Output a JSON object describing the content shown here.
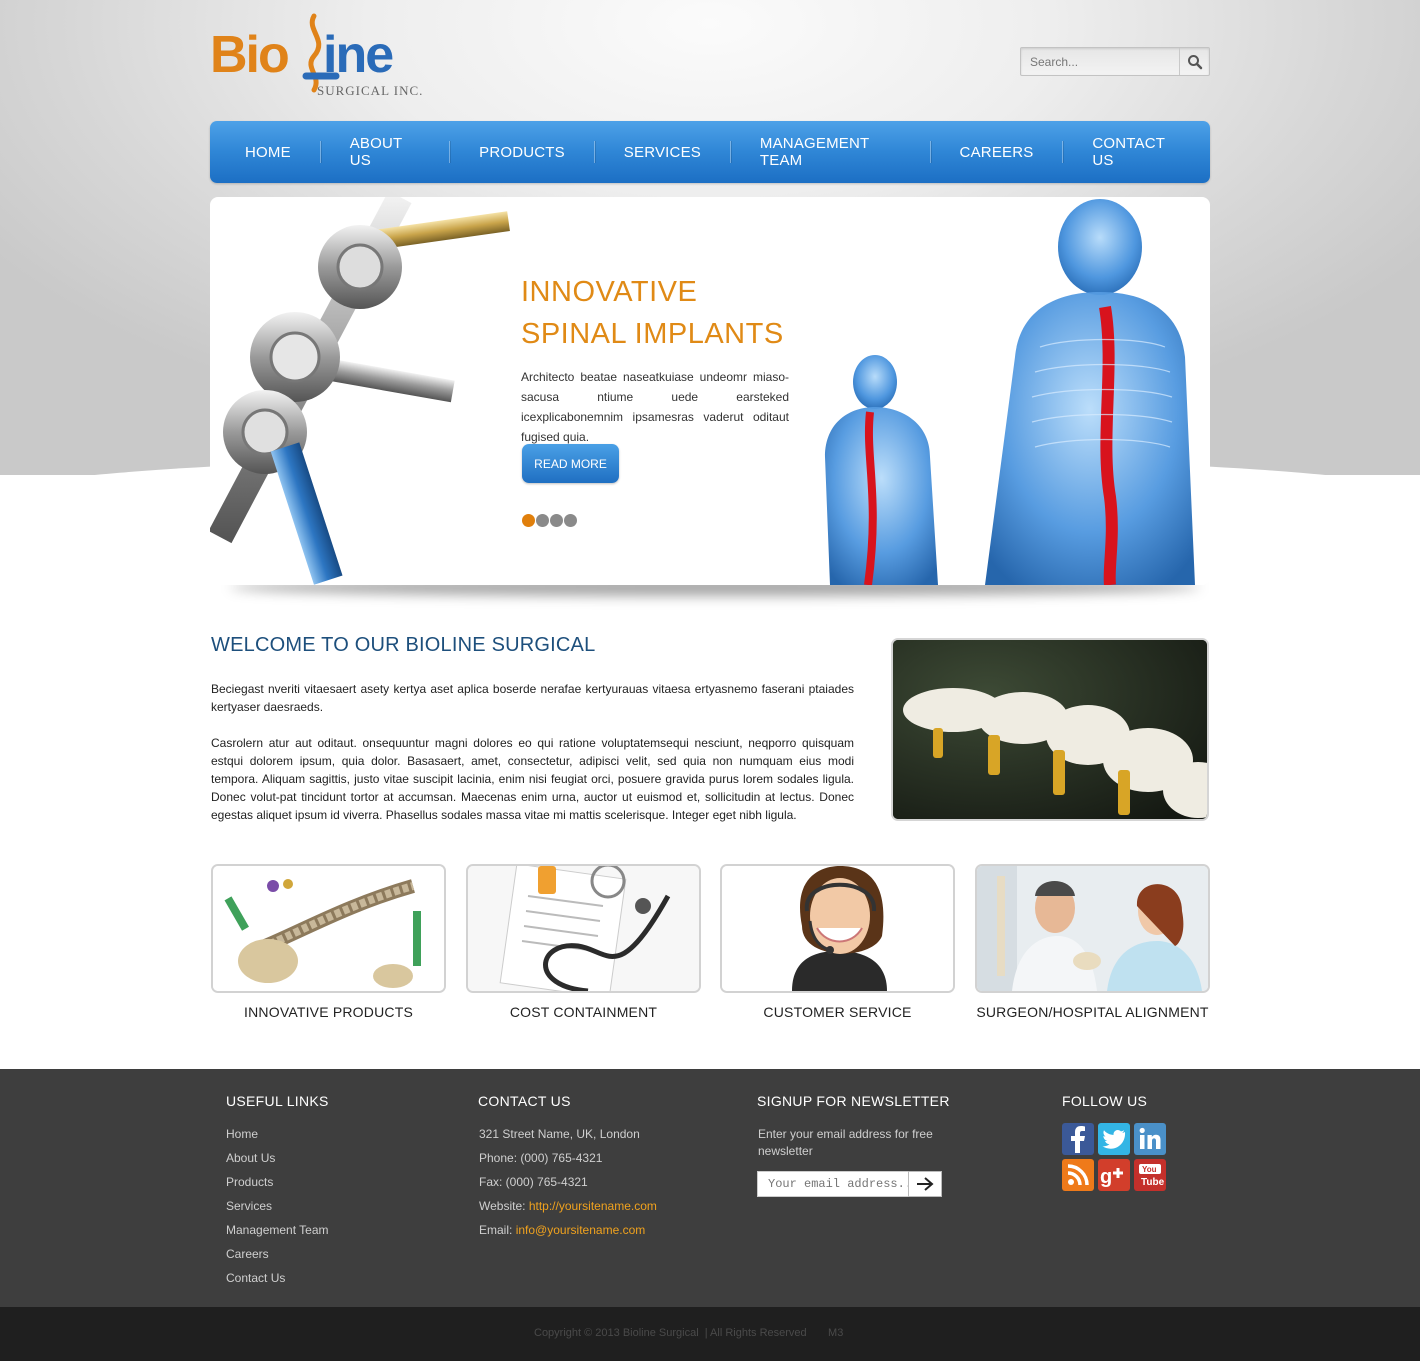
{
  "header": {
    "logo_text": "BioLine",
    "logo_sub": "SURGICAL INC.",
    "search_placeholder": "Search..."
  },
  "nav": {
    "items": [
      "HOME",
      "ABOUT US",
      "PRODUCTS",
      "SERVICES",
      "MANAGEMENT TEAM",
      "CAREERS",
      "CONTACT US"
    ]
  },
  "hero": {
    "title_line1": "INNOVATIVE",
    "title_line2": "SPINAL IMPLANTS",
    "text": "Architecto beatae naseatkuiase undeomr miaso-sacusa ntiume uede earsteked icexplicabonemnim ipsamesras vaderut oditaut fugised quia.",
    "button": "READ MORE",
    "slide_count": 4,
    "active_slide": 1
  },
  "welcome": {
    "title": "WELCOME TO OUR BIOLINE SURGICAL",
    "p1": "Beciegast nveriti vitaesaert asety kertya aset aplica boserde nerafae kertyurauas vitaesa ertyasnemo faserani ptaiades kertyaser daesraeds.",
    "p2": "Casrolern atur aut oditaut. onsequuntur magni dolores eo qui ratione voluptatemsequi nesciunt, neqporro quisquam estqui dolorem ipsum, quia dolor. Basasaert, amet, consectetur, adipisci velit, sed quia non numquam eius modi tempora. Aliquam sagittis, justo vitae suscipit lacinia, enim nisi feugiat orci, posuere gravida purus lorem sodales ligula. Donec volut-pat tincidunt tortor at accumsan. Maecenas enim urna, auctor ut euismod et, sollicitudin at lectus. Donec egestas aliquet ipsum id viverra. Phasellus sodales massa vitae mi mattis scelerisque. Integer eget nibh ligula."
  },
  "features": [
    {
      "label": "INNOVATIVE PRODUCTS"
    },
    {
      "label": "COST CONTAINMENT"
    },
    {
      "label": "CUSTOMER SERVICE"
    },
    {
      "label": "SURGEON/HOSPITAL ALIGNMENT"
    }
  ],
  "footer": {
    "links_title": "USEFUL LINKS",
    "links": [
      "Home",
      "About Us",
      "Products",
      "Services",
      "Management Team",
      "Careers",
      "Contact Us"
    ],
    "contact_title": "CONTACT US",
    "address": "321 Street Name, UK, London",
    "phone": "Phone: (000) 765-4321",
    "fax": "Fax: (000) 765-4321",
    "website_label": "Website: ",
    "website": "http://yoursitename.com",
    "email_label": "Email: ",
    "email": "info@yoursitename.com",
    "newsletter_title": "SIGNUP FOR NEWSLETTER",
    "newsletter_text": "Enter your email address for free newsletter",
    "newsletter_placeholder": "Your email address...",
    "follow_title": "FOLLOW US",
    "social": [
      "facebook-icon",
      "twitter-icon",
      "linkedin-icon",
      "rss-icon",
      "google-plus-icon",
      "youtube-icon"
    ],
    "copyright": "Copyright © 2013 Bioline Surgical  | All Rights Reserved       M3"
  },
  "colors": {
    "accent_orange": "#e08a16",
    "nav_blue": "#2f86d6",
    "heading_blue": "#1d4f7c",
    "footer_bg": "#3e3e3e"
  }
}
